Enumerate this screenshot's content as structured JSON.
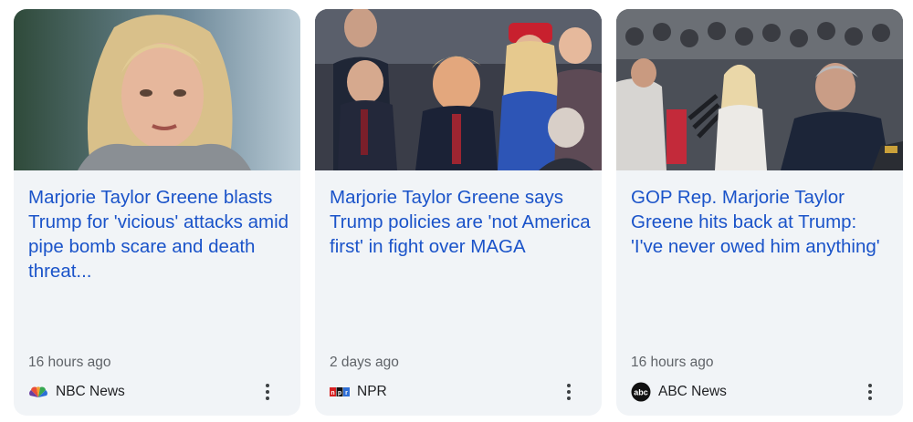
{
  "cards": [
    {
      "headline": "Marjorie Taylor Greene blasts Trump for 'vicious' attacks amid pipe bomb scare and death threat...",
      "time": "16 hours ago",
      "source": "NBC News",
      "logo_icon": "nbc-peacock-icon"
    },
    {
      "headline": "Marjorie Taylor Greene says Trump policies are 'not America first' in fight over MAGA",
      "time": "2 days ago",
      "source": "NPR",
      "logo_icon": "npr-logo-icon"
    },
    {
      "headline": "GOP Rep. Marjorie Taylor Greene hits back at Trump: 'I've never owed him anything'",
      "time": "16 hours ago",
      "source": "ABC News",
      "logo_icon": "abc-logo-icon"
    }
  ],
  "colors": {
    "card_bg": "#f1f4f7",
    "headline": "#1a53c9",
    "meta": "#5f6368"
  }
}
